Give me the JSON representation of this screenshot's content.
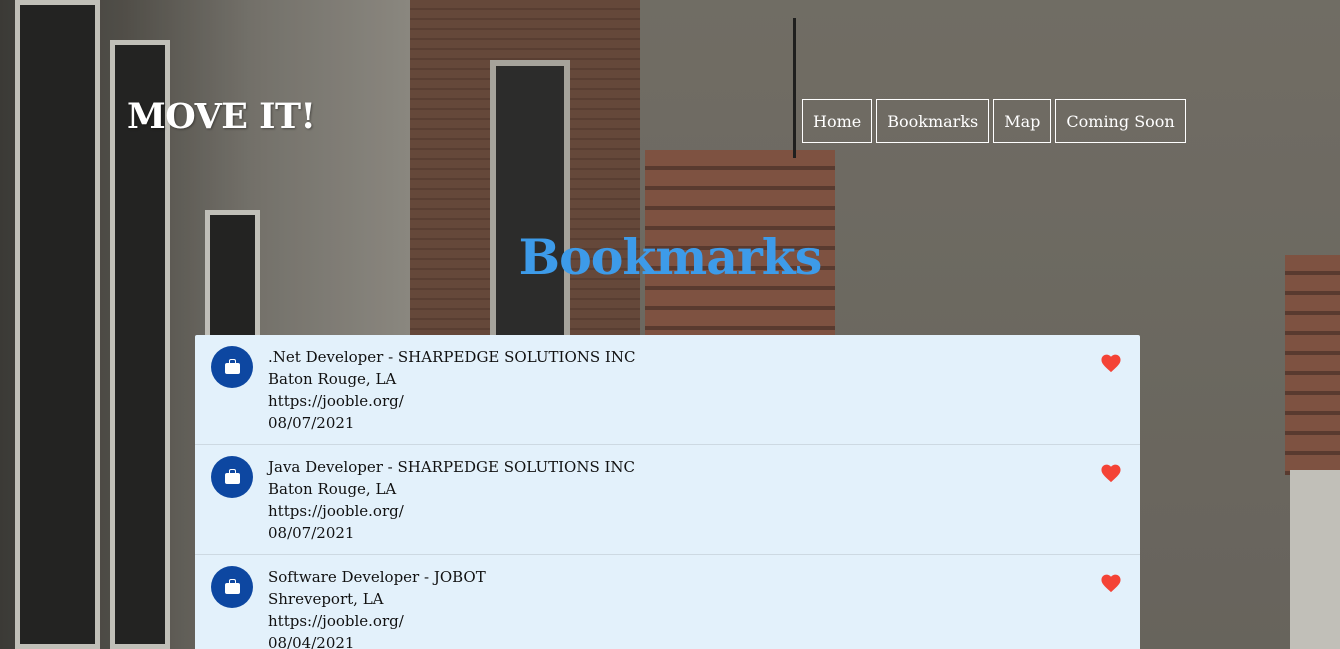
{
  "brand": {
    "logo": "MOVE IT!"
  },
  "nav": {
    "items": [
      {
        "label": "Home"
      },
      {
        "label": "Bookmarks"
      },
      {
        "label": "Map"
      },
      {
        "label": "Coming Soon"
      }
    ]
  },
  "page": {
    "title": "Bookmarks"
  },
  "colors": {
    "accent": "#3d9be9",
    "avatar": "#0d47a1",
    "heart": "#f44336",
    "card": "#e3f1fb"
  },
  "bookmarks": [
    {
      "title": ".Net Developer - SHARPEDGE SOLUTIONS INC",
      "location": "Baton Rouge, LA",
      "source": "https://jooble.org/",
      "date": "08/07/2021",
      "icon": "briefcase-icon",
      "fav_icon": "heart-icon"
    },
    {
      "title": "Java Developer - SHARPEDGE SOLUTIONS INC",
      "location": "Baton Rouge, LA",
      "source": "https://jooble.org/",
      "date": "08/07/2021",
      "icon": "briefcase-icon",
      "fav_icon": "heart-icon"
    },
    {
      "title": "Software Developer - JOBOT",
      "location": "Shreveport, LA",
      "source": "https://jooble.org/",
      "date": "08/04/2021",
      "icon": "briefcase-icon",
      "fav_icon": "heart-icon"
    }
  ]
}
